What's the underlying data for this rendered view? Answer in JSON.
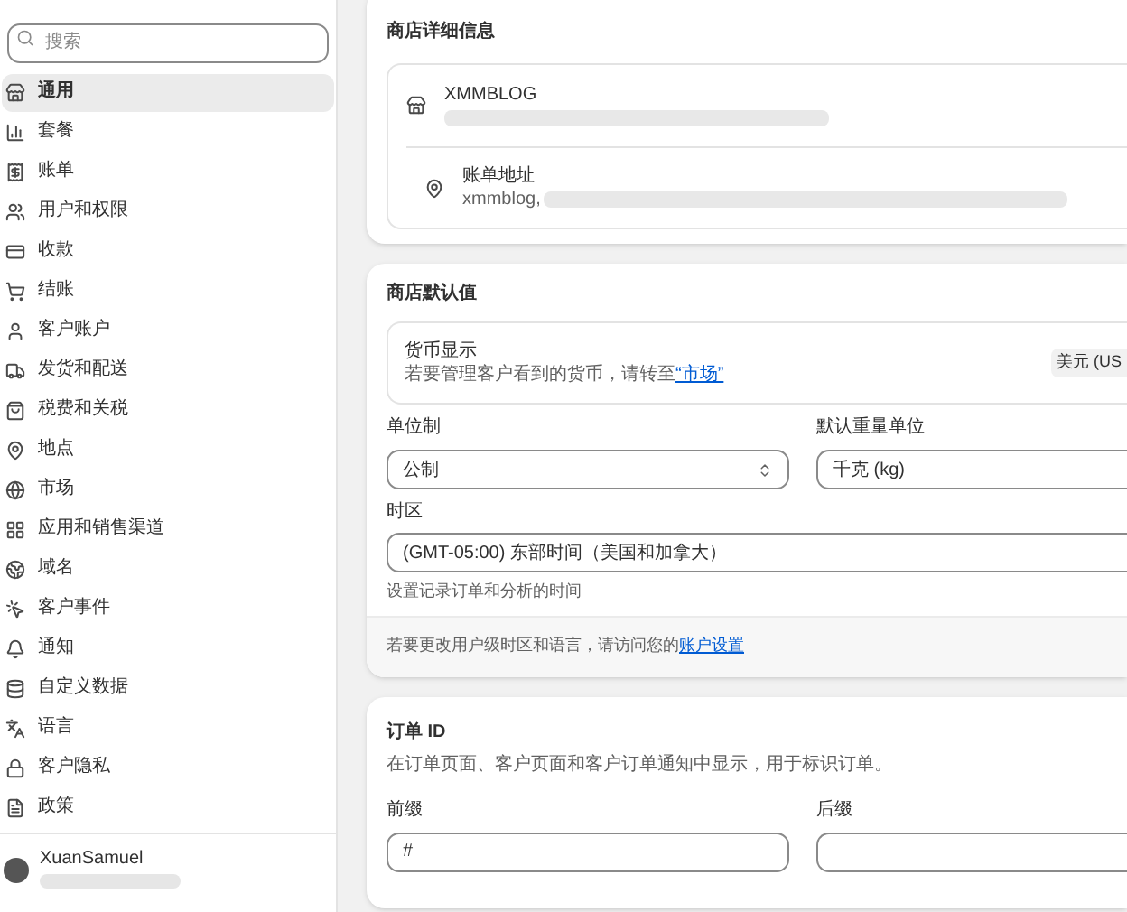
{
  "sidebar": {
    "search": {
      "placeholder": "搜索"
    },
    "items": [
      {
        "label": "通用",
        "selected": true
      },
      {
        "label": "套餐",
        "selected": false
      },
      {
        "label": "账单",
        "selected": false
      },
      {
        "label": "用户和权限",
        "selected": false
      },
      {
        "label": "收款",
        "selected": false
      },
      {
        "label": "结账",
        "selected": false
      },
      {
        "label": "客户账户",
        "selected": false
      },
      {
        "label": "发货和配送",
        "selected": false
      },
      {
        "label": "税费和关税",
        "selected": false
      },
      {
        "label": "地点",
        "selected": false
      },
      {
        "label": "市场",
        "selected": false
      },
      {
        "label": "应用和销售渠道",
        "selected": false
      },
      {
        "label": "域名",
        "selected": false
      },
      {
        "label": "客户事件",
        "selected": false
      },
      {
        "label": "通知",
        "selected": false
      },
      {
        "label": "自定义数据",
        "selected": false
      },
      {
        "label": "语言",
        "selected": false
      },
      {
        "label": "客户隐私",
        "selected": false
      },
      {
        "label": "政策",
        "selected": false
      }
    ],
    "user": {
      "name": "XuanSamuel"
    }
  },
  "store_details": {
    "title": "商店详细信息",
    "rows": [
      {
        "title": "XMMBLOG"
      },
      {
        "title": "账单地址",
        "value": "xmmblog,"
      }
    ]
  },
  "store_defaults": {
    "title": "商店默认值",
    "currency": {
      "title": "货币显示",
      "description": "若要管理客户看到的货币，请转至",
      "link": "“市场”",
      "value": "美元 (US"
    },
    "unit_system": {
      "label": "单位制",
      "value": "公制"
    },
    "weight_unit": {
      "label": "默认重量单位",
      "value": "千克 (kg)"
    },
    "timezone": {
      "label": "时区",
      "value": "(GMT-05:00) 东部时间（美国和加拿大）",
      "help": "设置记录订单和分析的时间"
    },
    "footer": {
      "text": "若要更改用户级时区和语言，请访问您的",
      "link": "账户设置"
    }
  },
  "order_id": {
    "title": "订单 ID",
    "description": "在订单页面、客户页面和客户订单通知中显示，用于标识订单。",
    "prefix": {
      "label": "前缀",
      "value": "#"
    },
    "suffix": {
      "label": "后缀"
    }
  }
}
